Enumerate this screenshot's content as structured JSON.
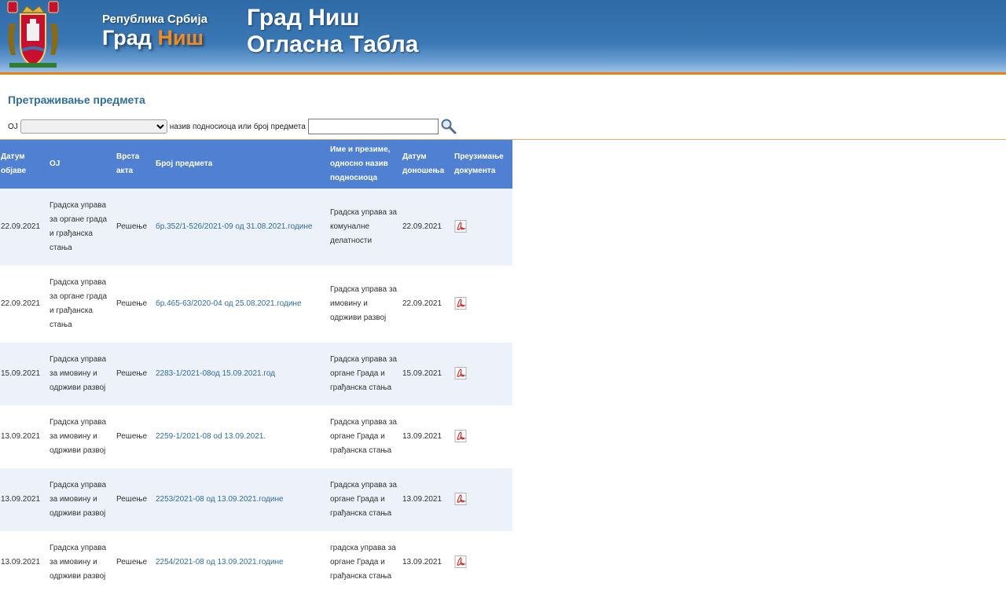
{
  "header": {
    "brand_small": "Република Србија",
    "brand_word": "Град",
    "brand_accent": "Ниш",
    "title_line1": "Град Ниш",
    "title_line2": "Огласна Табла"
  },
  "search": {
    "heading": "Претраживање предмета",
    "oj_label": "ОЈ",
    "oj_selected": "",
    "query_label": "назив подносиоца или број предмета",
    "query_value": ""
  },
  "table": {
    "headers": {
      "date_published": "Датум објаве",
      "oj": "ОЈ",
      "act_type": "Врста акта",
      "case_number": "Број предмета",
      "applicant": "Име и презиме, односно назив подносиоца",
      "date_adopted": "Датум доношења",
      "download": "Преузимање документа"
    },
    "rows": [
      {
        "date_published": "22.09.2021",
        "oj": "Градска управа за органе града и грађанска стања",
        "act_type": "Решење",
        "case_number": "бр.352/1-526/2021-09 од 31.08.2021.године",
        "applicant": "Градска управа за комуналне делатности",
        "date_adopted": "22.09.2021"
      },
      {
        "date_published": "22.09.2021",
        "oj": "Градска управа за органе града и грађанска стања",
        "act_type": "Решење",
        "case_number": "бр.465-63/2020-04 од 25.08.2021.године",
        "applicant": "Градска управа за имовину и одрживи развој",
        "date_adopted": "22.09.2021"
      },
      {
        "date_published": "15.09.2021",
        "oj": "Градска управа за имовину и одрживи развој",
        "act_type": "Решење",
        "case_number": "2283-1/2021-08од 15.09.2021.год",
        "applicant": "Градска управа за органе Града и грађанска стања",
        "date_adopted": "15.09.2021"
      },
      {
        "date_published": "13.09.2021",
        "oj": "Градска управа за имовину и одрживи развој",
        "act_type": "Решење",
        "case_number": "2259-1/2021-08 od 13.09.2021.",
        "applicant": "Градска управа за органе Града и грађанска стања",
        "date_adopted": "13.09.2021"
      },
      {
        "date_published": "13.09.2021",
        "oj": "Градска управа за имовину и одрживи развој",
        "act_type": "Решење",
        "case_number": "2253/2021-08 од 13.09.2021.године",
        "applicant": "Градска управа за органе Града и грађанска стања",
        "date_adopted": "13.09.2021"
      },
      {
        "date_published": "13.09.2021",
        "oj": "Градска управа за имовину и одрживи развој",
        "act_type": "Решење",
        "case_number": "2254/2021-08 од 13.09.2021.године",
        "applicant": "градска управа за органе Града и грађанска стања",
        "date_adopted": "13.09.2021"
      }
    ]
  },
  "icons": {
    "crest": "city-crest-icon",
    "search": "magnifier-icon",
    "download": "pdf-icon"
  },
  "colors": {
    "header_blue": "#3a78b5",
    "accent_orange": "#f28a1e",
    "table_header": "#4f80d1",
    "row_alt": "#ecf1fa",
    "link": "#2f6ea0"
  }
}
